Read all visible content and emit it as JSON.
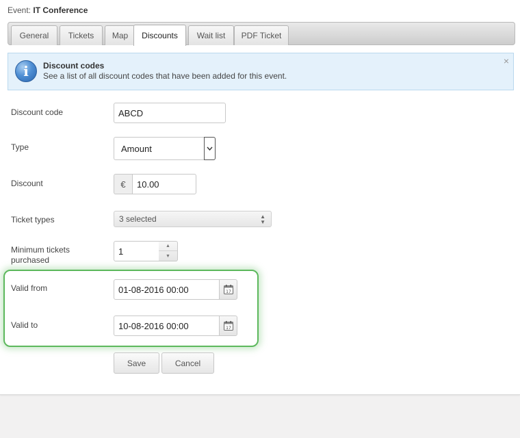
{
  "header": {
    "event_prefix": "Event:",
    "event_name": "IT Conference"
  },
  "tabs": [
    {
      "label": "General",
      "active": false
    },
    {
      "label": "Tickets",
      "active": false
    },
    {
      "label": "Map",
      "active": false
    },
    {
      "label": "Discounts",
      "active": true
    },
    {
      "label": "Wait list",
      "active": false
    },
    {
      "label": "PDF Ticket",
      "active": false
    }
  ],
  "info": {
    "title": "Discount codes",
    "text": "See a list of all discount codes that have been added for this event.",
    "close_glyph": "×",
    "icon": "info-icon"
  },
  "form": {
    "discount_code": {
      "label": "Discount code",
      "value": "ABCD"
    },
    "type": {
      "label": "Type",
      "value": "Amount"
    },
    "discount": {
      "label": "Discount",
      "currency": "€",
      "value": "10.00"
    },
    "ticket_types": {
      "label": "Ticket types",
      "value": "3 selected"
    },
    "minimum_tickets": {
      "label_line1": "Minimum tickets",
      "label_line2": "purchased",
      "value": "1"
    },
    "valid_from": {
      "label": "Valid from",
      "value": "01-08-2016 00:00"
    },
    "valid_to": {
      "label": "Valid to",
      "value": "10-08-2016 00:00"
    }
  },
  "buttons": {
    "save": "Save",
    "cancel": "Cancel"
  },
  "colors": {
    "highlight": "#5cb85c",
    "info_bg": "#e4f1fb"
  }
}
